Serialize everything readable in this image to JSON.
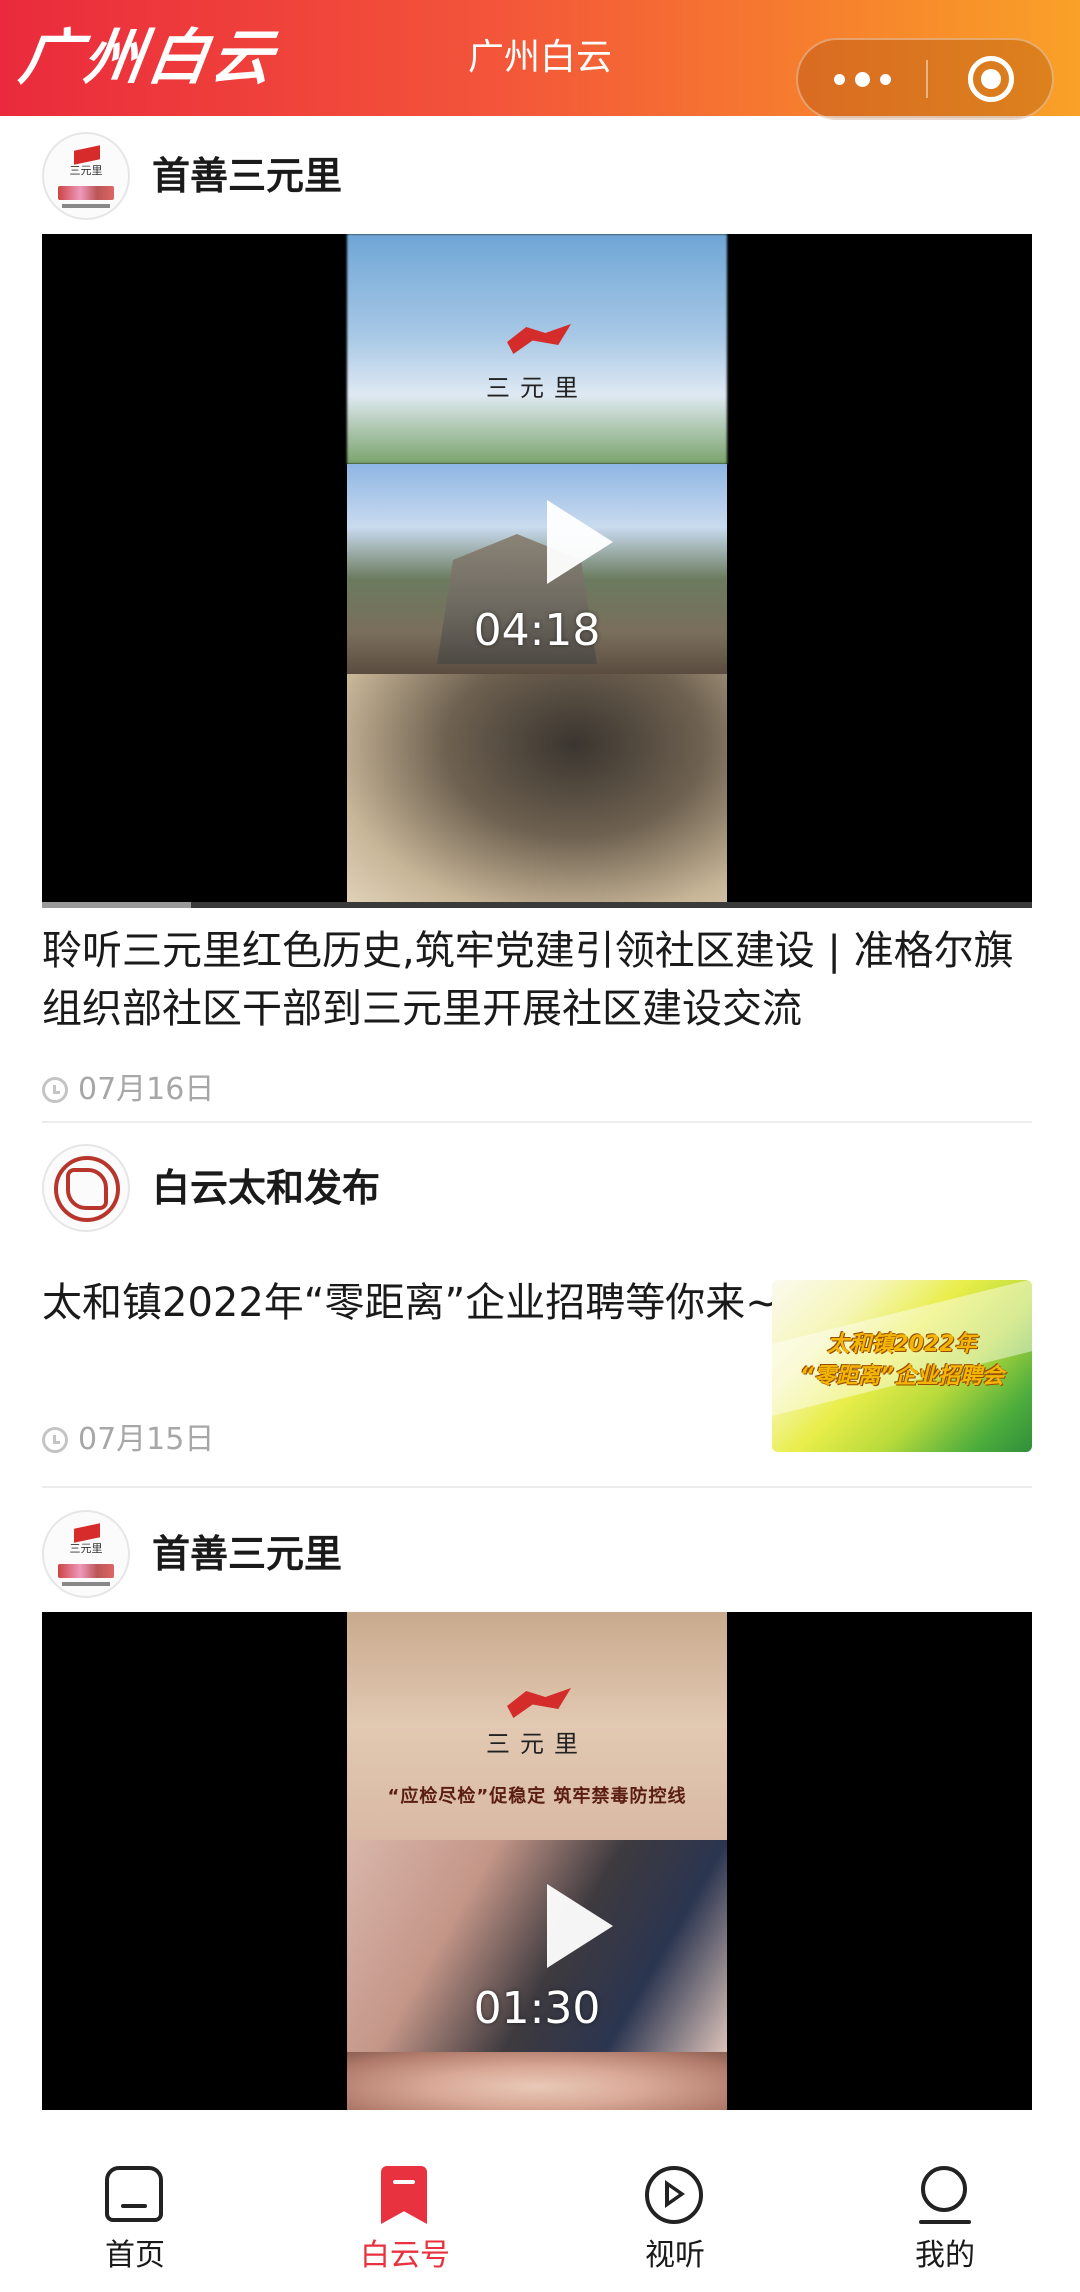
{
  "header": {
    "logo": "广州白云",
    "title": "广州白云"
  },
  "feed": [
    {
      "account": "首善三元里",
      "video": {
        "brand": "三元里",
        "duration": "04:18",
        "progress_fraction": 0.15
      },
      "title": "聆听三元里红色历史,筑牢党建引领社区建设 | 准格尔旗组织部社区干部到三元里开展社区建设交流",
      "date": "07月16日"
    },
    {
      "account": "白云太和发布",
      "title": "太和镇2022年“零距离”企业招聘等你来~",
      "thumbnail": {
        "line1": "太和镇2022年",
        "line2": "“零距离”企业招聘会"
      },
      "date": "07月15日"
    },
    {
      "account": "首善三元里",
      "video": {
        "brand": "三元里",
        "slogan": "“应检尽检”促稳定  筑牢禁毒防控线",
        "duration": "01:30"
      }
    }
  ],
  "bottom_nav": [
    {
      "label": "首页",
      "icon": "home-icon",
      "active": false
    },
    {
      "label": "白云号",
      "icon": "bookmark-icon",
      "active": true
    },
    {
      "label": "视听",
      "icon": "play-circle-icon",
      "active": false
    },
    {
      "label": "我的",
      "icon": "user-icon",
      "active": false
    }
  ],
  "colors": {
    "accent": "#e9323f",
    "header_gradient_start": "#ea2a3c",
    "header_gradient_end": "#f9a128",
    "date_gray": "#a7a7a7"
  }
}
